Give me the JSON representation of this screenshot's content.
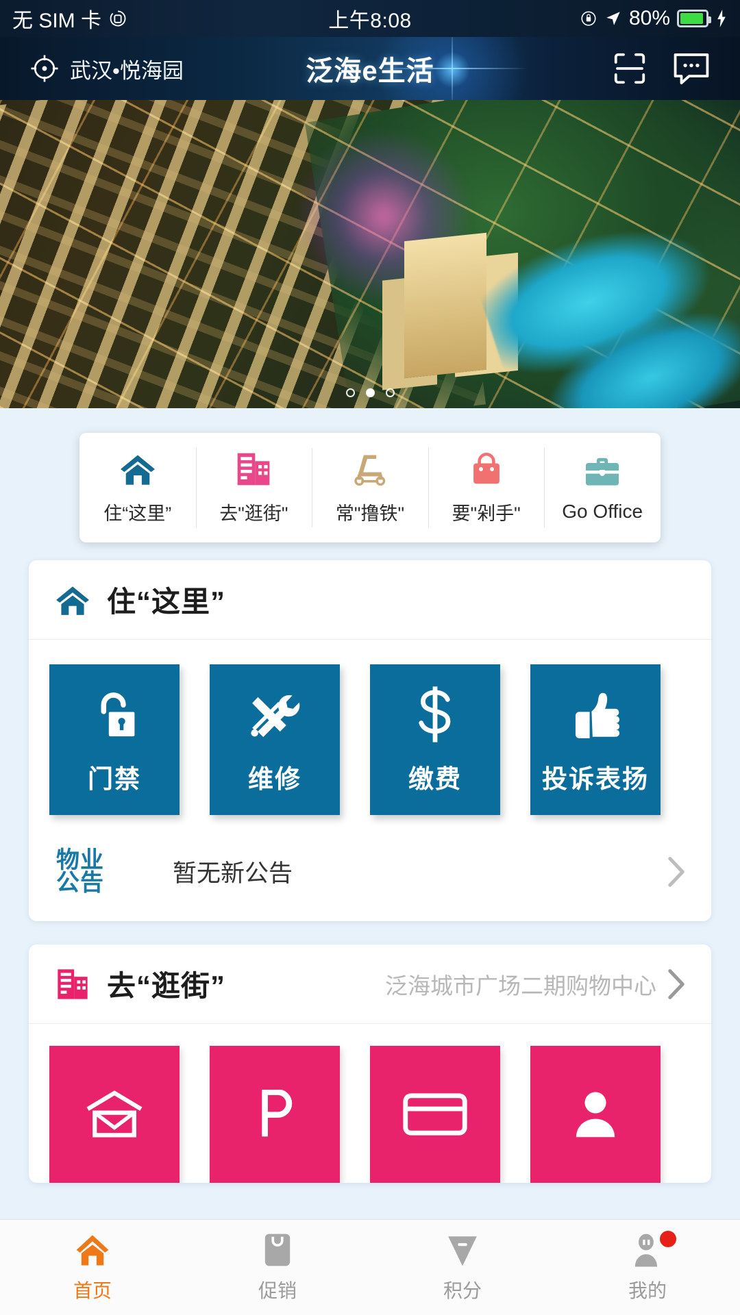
{
  "status_bar": {
    "carrier": "无 SIM 卡",
    "rotation_icon": "rotation-lock-icon",
    "time": "上午8:08",
    "lock_icon": "orientation-lock-icon",
    "location_icon": "location-arrow-icon",
    "battery_percent": "80%",
    "charging_icon": "lightning-bolt-icon",
    "battery_color": "#3ddc45"
  },
  "header": {
    "location_icon": "location-target-icon",
    "location": "武汉•悦海园",
    "title": "泛海e生活",
    "scan_icon": "scan-qr-icon",
    "chat_icon": "chat-bubble-icon"
  },
  "carousel": {
    "dots": 3,
    "active_index": 1
  },
  "quick_nav": {
    "items": [
      {
        "icon": "home-icon",
        "label": "住“这里”",
        "color": "#136a93"
      },
      {
        "icon": "building-icon",
        "label": "去\"逛街\"",
        "color": "#e8478a"
      },
      {
        "icon": "treadmill-icon",
        "label": "常\"撸铁\"",
        "color": "#c9a877"
      },
      {
        "icon": "handbag-icon",
        "label": "要\"剁手\"",
        "color": "#f0716f"
      },
      {
        "icon": "briefcase-icon",
        "label": "Go Office",
        "color": "#6fb5b5"
      }
    ]
  },
  "live_here": {
    "icon": "home-icon",
    "title": "住“这里”",
    "accent": "#0b6d9b",
    "tiles": [
      {
        "icon": "unlock-icon",
        "label": "门禁"
      },
      {
        "icon": "tools-icon",
        "label": "维修"
      },
      {
        "icon": "dollar-icon",
        "label": "缴费"
      },
      {
        "icon": "thumbs-up-icon",
        "label": "投诉表扬"
      }
    ],
    "notice": {
      "badge_line1": "物业",
      "badge_line2": "公告",
      "badge_color": "#1878a6",
      "text": "暂无新公告",
      "chevron": "chevron-right-icon"
    }
  },
  "shopping": {
    "icon": "building-icon",
    "title": "去“逛街”",
    "subtitle": "泛海城市广场二期购物中心",
    "chevron": "chevron-right-icon",
    "accent": "#e8236c",
    "tiles": [
      {
        "icon": "store-icon"
      },
      {
        "icon": "parking-icon"
      },
      {
        "icon": "card-icon"
      },
      {
        "icon": "person-icon"
      }
    ]
  },
  "tabbar": {
    "active_color": "#ef7918",
    "inactive_color": "#9b9b9b",
    "items": [
      {
        "icon": "home-icon",
        "label": "首页",
        "active": true,
        "badge": false
      },
      {
        "icon": "tag-icon",
        "label": "促销",
        "active": false,
        "badge": false
      },
      {
        "icon": "points-icon",
        "label": "积分",
        "active": false,
        "badge": false
      },
      {
        "icon": "profile-icon",
        "label": "我的",
        "active": false,
        "badge": true
      }
    ]
  }
}
